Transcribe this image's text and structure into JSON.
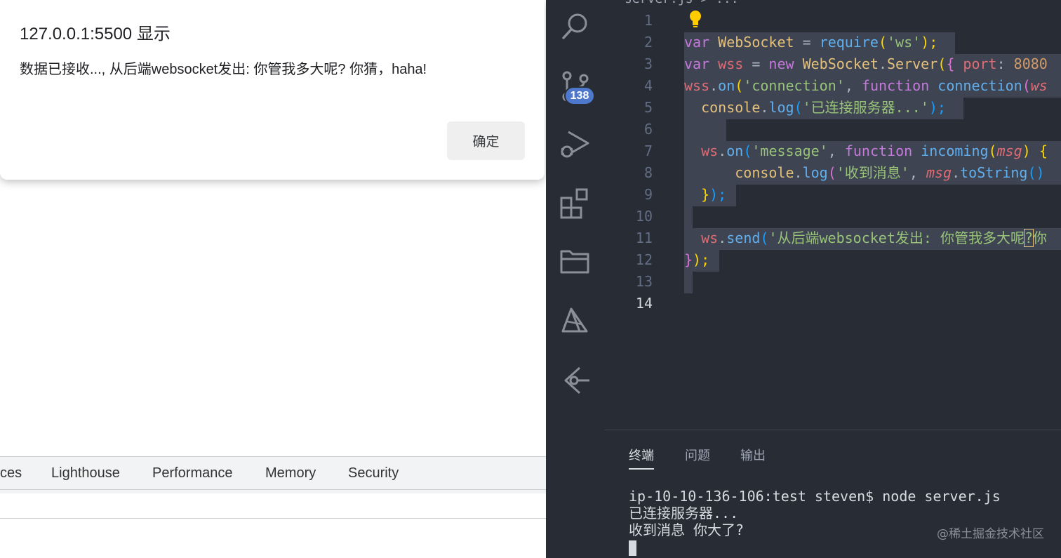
{
  "browser": {
    "alert": {
      "title": "127.0.0.1:5500 显示",
      "message": "数据已接收..., 从后端websocket发出: 你管我多大呢? 你猜，haha!",
      "ok_label": "确定"
    },
    "devtools_tabs": [
      "ces",
      "Lighthouse",
      "Performance",
      "Memory",
      "Security"
    ]
  },
  "editor": {
    "breadcrumb": "server.js > ...",
    "scm_badge": "138",
    "activity_icons": [
      "search-icon",
      "source-control-icon",
      "run-debug-icon",
      "extensions-icon",
      "explorer-icon",
      "remote-icon",
      "gitlens-icon"
    ],
    "line_numbers": [
      "1",
      "2",
      "3",
      "4",
      "5",
      "6",
      "7",
      "8",
      "9",
      "10",
      "11",
      "12",
      "13",
      "14"
    ],
    "active_line": "14",
    "code": {
      "l2": [
        "var",
        " ",
        "WebSocket",
        " = ",
        "require",
        "(",
        "'ws'",
        ");"
      ],
      "l3": [
        "var",
        " ",
        "wss",
        " = ",
        "new",
        " ",
        "WebSocket",
        ".",
        "Server",
        "(",
        "{",
        " ",
        "port",
        ": ",
        "8080"
      ],
      "l4": [
        "wss",
        ".",
        "on",
        "(",
        "'connection'",
        ", ",
        "function",
        " ",
        "connection",
        "(",
        "ws"
      ],
      "l5": [
        "  ",
        "console",
        ".",
        "log",
        "(",
        "'已连接服务器...'",
        ");"
      ],
      "l7": [
        "  ",
        "ws",
        ".",
        "on",
        "(",
        "'message'",
        ", ",
        "function",
        " ",
        "incoming",
        "(",
        "msg",
        ")",
        " ",
        "{"
      ],
      "l8": [
        "      ",
        "console",
        ".",
        "log",
        "(",
        "'收到消息'",
        ", ",
        "msg",
        ".",
        "toString",
        "()"
      ],
      "l9": [
        "  ",
        "}",
        ");"
      ],
      "l11": [
        "  ",
        "ws",
        ".",
        "send",
        "(",
        "'从后端websocket发出: 你管我多大呢",
        "?",
        "你"
      ],
      "l12": [
        "}",
        ");"
      ]
    },
    "panel_tabs": [
      "终端",
      "问题",
      "输出"
    ],
    "terminal_lines": [
      "ip-10-10-136-106:test steven$ node server.js",
      "已连接服务器...",
      "收到消息 你大了?"
    ],
    "watermark": "@稀土掘金技术社区"
  },
  "colors": {
    "editor_bg": "#282c34",
    "badge": "#4d78cc",
    "keyword": "#c678dd",
    "string": "#98c379",
    "function": "#61afef",
    "class": "#e5c07b"
  }
}
